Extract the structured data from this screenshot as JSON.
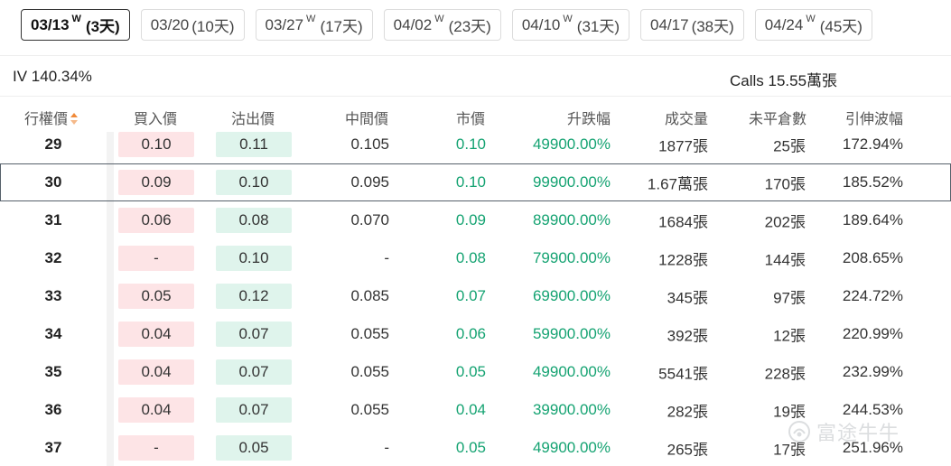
{
  "tabs": [
    {
      "date": "03/13",
      "sup": "W",
      "days": "(3天)",
      "active": true
    },
    {
      "date": "03/20",
      "sup": "",
      "days": "(10天)",
      "active": false
    },
    {
      "date": "03/27",
      "sup": "W",
      "days": "(17天)",
      "active": false
    },
    {
      "date": "04/02",
      "sup": "W",
      "days": "(23天)",
      "active": false
    },
    {
      "date": "04/10",
      "sup": "W",
      "days": "(31天)",
      "active": false
    },
    {
      "date": "04/17",
      "sup": "",
      "days": "(38天)",
      "active": false
    },
    {
      "date": "04/24",
      "sup": "W",
      "days": "(45天)",
      "active": false
    }
  ],
  "info": {
    "iv": "IV 140.34%",
    "calls": "Calls 15.55萬張"
  },
  "columns": {
    "strike": "行權價",
    "bid": "買入價",
    "ask": "沽出價",
    "mid": "中間價",
    "market": "市價",
    "change": "升跌幅",
    "volume": "成交量",
    "open_interest": "未平倉數",
    "implied_vol": "引伸波幅"
  },
  "rows": [
    {
      "strike": "29",
      "bid": "0.10",
      "ask": "0.11",
      "mid": "0.105",
      "market": "0.10",
      "change": "49900.00%",
      "volume": "1877張",
      "oi": "25張",
      "iv": "172.94%",
      "selected": false
    },
    {
      "strike": "30",
      "bid": "0.09",
      "ask": "0.10",
      "mid": "0.095",
      "market": "0.10",
      "change": "99900.00%",
      "volume": "1.67萬張",
      "oi": "170張",
      "iv": "185.52%",
      "selected": true
    },
    {
      "strike": "31",
      "bid": "0.06",
      "ask": "0.08",
      "mid": "0.070",
      "market": "0.09",
      "change": "89900.00%",
      "volume": "1684張",
      "oi": "202張",
      "iv": "189.64%",
      "selected": false
    },
    {
      "strike": "32",
      "bid": "-",
      "ask": "0.10",
      "mid": "-",
      "market": "0.08",
      "change": "79900.00%",
      "volume": "1228張",
      "oi": "144張",
      "iv": "208.65%",
      "selected": false
    },
    {
      "strike": "33",
      "bid": "0.05",
      "ask": "0.12",
      "mid": "0.085",
      "market": "0.07",
      "change": "69900.00%",
      "volume": "345張",
      "oi": "97張",
      "iv": "224.72%",
      "selected": false
    },
    {
      "strike": "34",
      "bid": "0.04",
      "ask": "0.07",
      "mid": "0.055",
      "market": "0.06",
      "change": "59900.00%",
      "volume": "392張",
      "oi": "12張",
      "iv": "220.99%",
      "selected": false
    },
    {
      "strike": "35",
      "bid": "0.04",
      "ask": "0.07",
      "mid": "0.055",
      "market": "0.05",
      "change": "49900.00%",
      "volume": "5541張",
      "oi": "228張",
      "iv": "232.99%",
      "selected": false
    },
    {
      "strike": "36",
      "bid": "0.04",
      "ask": "0.07",
      "mid": "0.055",
      "market": "0.04",
      "change": "39900.00%",
      "volume": "282張",
      "oi": "19張",
      "iv": "244.53%",
      "selected": false
    },
    {
      "strike": "37",
      "bid": "-",
      "ask": "0.05",
      "mid": "-",
      "market": "0.05",
      "change": "49900.00%",
      "volume": "265張",
      "oi": "17張",
      "iv": "251.96%",
      "selected": false
    }
  ],
  "watermark": {
    "text": "富途牛牛",
    "icon": "futu-logo-icon"
  },
  "colors": {
    "up_green": "#15a372",
    "bid_bg": "#fde4e6",
    "ask_bg": "#dff4ec",
    "sort_accent": "#f08a3a"
  }
}
